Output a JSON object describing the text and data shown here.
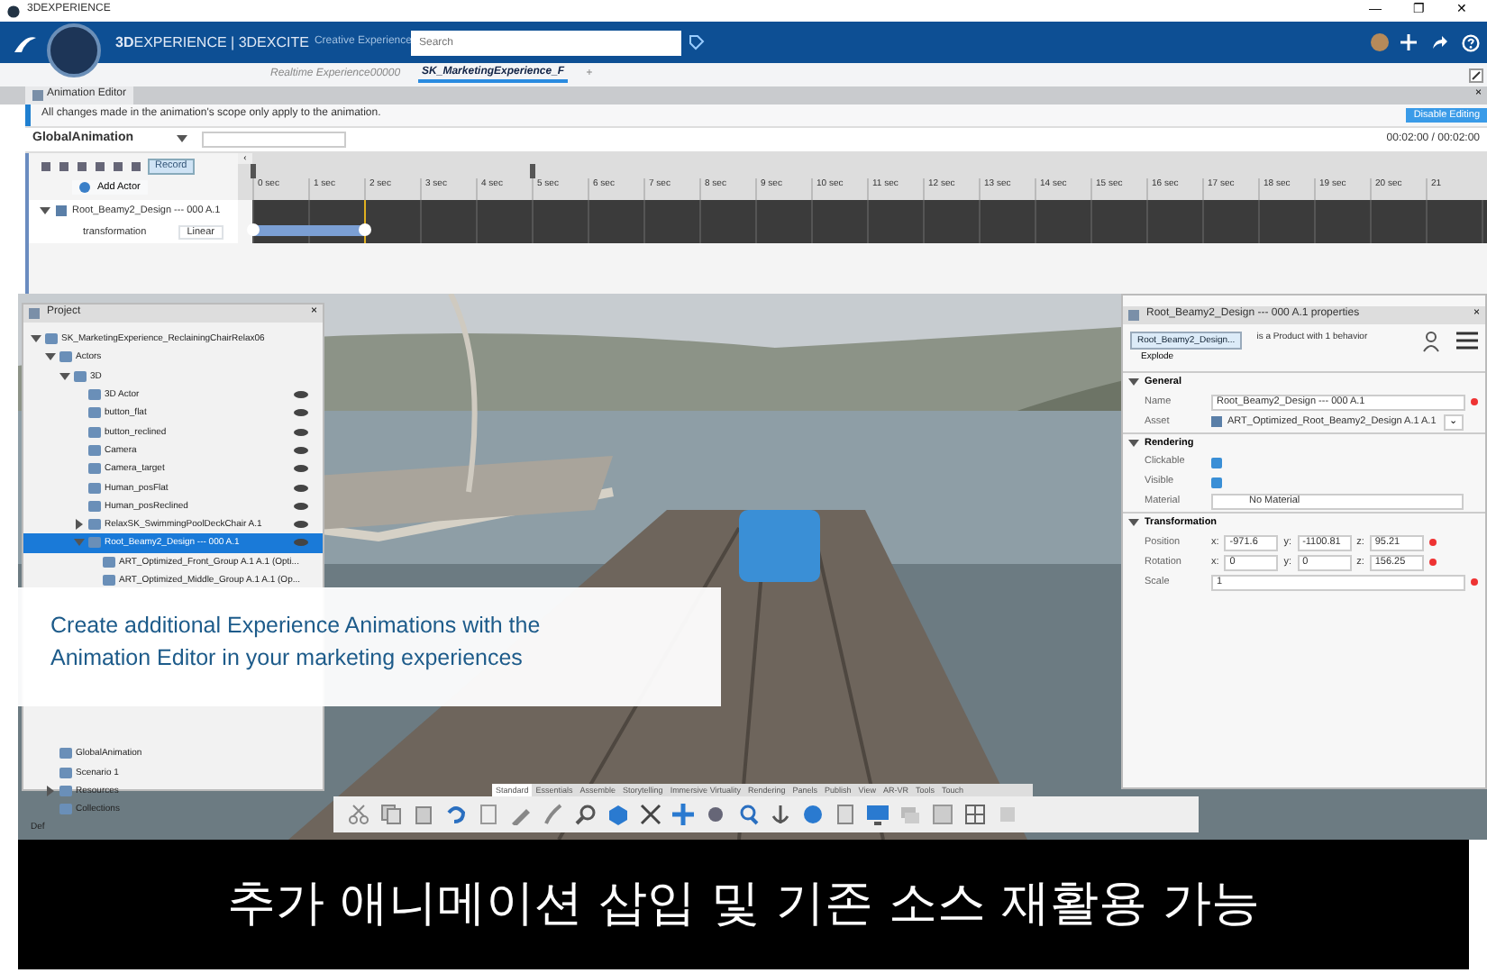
{
  "os_window": {
    "title": "3DEXPERIENCE",
    "controls": [
      "—",
      "❐",
      "✕"
    ]
  },
  "header": {
    "title": "**3D**EXPERIENCE | 3DEXCITE",
    "app": "Creative Experience",
    "search": {
      "placeholder": "Search"
    }
  },
  "doc_tabs": [
    {
      "label": "Realtime Experience00000",
      "selected": false
    },
    {
      "label": "SK_MarketingExperience_F",
      "selected": true
    }
  ],
  "new_tab": "+",
  "animation_editor": {
    "title": "Animation Editor",
    "close": "×",
    "info": "All changes made in the animation's scope only apply to the animation.",
    "disable_button": "Disable Editing",
    "animation": "GlobalAnimation",
    "time": "00:02:00 / 00:02:00",
    "record": "Record",
    "add_actor": "Add Actor",
    "collapse": "‹",
    "ruler": [
      {
        "label": "0 sec",
        "marker": true,
        "keyframe": true
      },
      {
        "label": "1 sec"
      },
      {
        "label": "2 sec",
        "keyframe": true,
        "playhead": true
      },
      {
        "label": "3 sec"
      },
      {
        "label": "4 sec"
      },
      {
        "label": "5 sec",
        "marker": true
      },
      {
        "label": "6 sec"
      },
      {
        "label": "7 sec"
      },
      {
        "label": "8 sec"
      },
      {
        "label": "9 sec"
      },
      {
        "label": "10 sec"
      },
      {
        "label": "11 sec"
      },
      {
        "label": "12 sec"
      },
      {
        "label": "13 sec"
      },
      {
        "label": "14 sec"
      },
      {
        "label": "15 sec"
      },
      {
        "label": "16 sec"
      },
      {
        "label": "17 sec"
      },
      {
        "label": "18 sec"
      },
      {
        "label": "19 sec"
      },
      {
        "label": "20 sec"
      },
      {
        "label": "21"
      }
    ],
    "tracks": [
      {
        "actor": "Root_Beamy2_Design --- 000 A.1",
        "expanded": true,
        "property": "transformation",
        "interpolation": "Linear"
      }
    ]
  },
  "project": {
    "title": "Project",
    "close": "×",
    "tree": [
      {
        "label": "SK_MarketingExperience_ReclainingChairRelax06",
        "expanded": true,
        "selected": false,
        "children": [
          {
            "label": "Actors",
            "expanded": true,
            "selected": false,
            "children": [
              {
                "label": "3D",
                "expanded": true,
                "selected": false,
                "children": [
                  {
                    "label": "3D Actor",
                    "selected": false
                  },
                  {
                    "label": "button_flat",
                    "selected": false
                  },
                  {
                    "label": "button_reclined",
                    "selected": false
                  },
                  {
                    "label": "Camera",
                    "selected": false
                  },
                  {
                    "label": "Camera_target",
                    "selected": false
                  },
                  {
                    "label": "Human_posFlat",
                    "selected": false
                  },
                  {
                    "label": "Human_posReclined",
                    "selected": false
                  },
                  {
                    "label": "RelaxSK_SwimmingPoolDeckChair A.1",
                    "expanded": false,
                    "selected": false
                  },
                  {
                    "label": "Root_Beamy2_Design --- 000 A.1",
                    "expanded": true,
                    "selected": true,
                    "children": [
                      {
                        "label": "ART_Optimized_Front_Group A.1 A.1 (Opti...",
                        "selected": false
                      },
                      {
                        "label": "ART_Optimized_Middle_Group A.1 A.1 (Op...",
                        "selected": false
                      }
                    ]
                  }
                ]
              }
            ]
          },
          {
            "label": "GlobalAnimation",
            "selected": false
          },
          {
            "label": "Scenario 1",
            "selected": false
          },
          {
            "label": "Resources",
            "expanded": false,
            "selected": false
          },
          {
            "label": "Collections",
            "selected": false
          }
        ]
      }
    ],
    "footer": "Def"
  },
  "properties": {
    "title": "Root_Beamy2_Design --- 000 A.1 properties",
    "close": "×",
    "object_button": "Root_Beamy2_Design...",
    "description": "is a Product with 1 behavior",
    "explode": "Explode",
    "sections": [
      {
        "title": "General",
        "fields": [
          {
            "kind": "text",
            "label": "Name",
            "value": "Root_Beamy2_Design --- 000 A.1"
          },
          {
            "kind": "asset",
            "label": "Asset",
            "value": "ART_Optimized_Root_Beamy2_Design A.1 A.1",
            "dropdown": "⌄"
          }
        ]
      },
      {
        "title": "Rendering",
        "fields": [
          {
            "kind": "check",
            "label": "Clickable",
            "checked": true
          },
          {
            "kind": "check",
            "label": "Visible",
            "checked": true
          },
          {
            "kind": "material",
            "label": "Material",
            "value": "No Material"
          }
        ]
      },
      {
        "title": "Transformation",
        "fields": [
          {
            "kind": "xyz",
            "label": "Position",
            "axes": [
              {
                "label": "x:",
                "value": "-971.6"
              },
              {
                "label": "y:",
                "value": "-1100.81"
              },
              {
                "label": "z:",
                "value": "95.21"
              }
            ]
          },
          {
            "kind": "xyz",
            "label": "Rotation",
            "axes": [
              {
                "label": "x:",
                "value": "0"
              },
              {
                "label": "y:",
                "value": "0"
              },
              {
                "label": "z:",
                "value": "156.25"
              }
            ]
          },
          {
            "kind": "text",
            "label": "Scale",
            "value": "1"
          }
        ]
      }
    ]
  },
  "caption": [
    "Create additional Experience Animations with the",
    "Animation Editor in your marketing experiences"
  ],
  "toolbar": {
    "tabs": [
      {
        "label": "Standard",
        "selected": true
      },
      {
        "label": "Essentials",
        "selected": false
      },
      {
        "label": "Assemble",
        "selected": false
      },
      {
        "label": "Storytelling",
        "selected": false
      },
      {
        "label": "Immersive Virtuality",
        "selected": false
      },
      {
        "label": "Rendering",
        "selected": false
      },
      {
        "label": "Panels",
        "selected": false
      },
      {
        "label": "Publish",
        "selected": false
      },
      {
        "label": "View",
        "selected": false
      },
      {
        "label": "AR-VR",
        "selected": false
      },
      {
        "label": "Tools",
        "selected": false
      },
      {
        "label": "Touch",
        "selected": false
      }
    ]
  },
  "subtitle": "추가 애니메이션 삽입 및 기존 소스 재활용 가능"
}
